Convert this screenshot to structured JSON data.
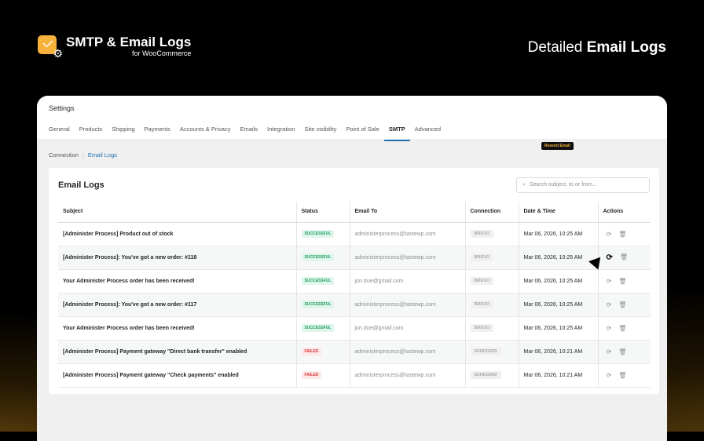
{
  "brand": {
    "title": "SMTP & Email Logs",
    "subtitle": "for WooCommerce"
  },
  "headline": {
    "normal": "Detailed ",
    "bold": "Email Logs"
  },
  "settings": {
    "title": "Settings",
    "tabs": [
      "General",
      "Products",
      "Shipping",
      "Payments",
      "Accounts & Privacy",
      "Emails",
      "Integration",
      "Site visibility",
      "Point of Sale",
      "SMTP",
      "Advanced"
    ],
    "active_tab": "SMTP"
  },
  "subnav": {
    "connection": "Connection",
    "separator": "|",
    "email_logs": "Email Logs"
  },
  "panel": {
    "title": "Email Logs",
    "search_placeholder": "Search subject, to or from...",
    "tooltip": "Resend Email"
  },
  "columns": [
    "Subject",
    "Status",
    "Email To",
    "Connection",
    "Date & Time",
    "Actions"
  ],
  "rows": [
    {
      "subject": "[Administer Process] Product out of stock",
      "status": "SUCCESSFUL",
      "to": "administerprocess@tastewp.com",
      "connection": "BREVO",
      "date": "Mar 06, 2026, 10:25 AM"
    },
    {
      "subject": "[Administer Process]: You've got a new order: #118",
      "status": "SUCCESSFUL",
      "to": "administerprocess@tastewp.com",
      "connection": "BREVO",
      "date": "Mar 06, 2026, 10:25 AM"
    },
    {
      "subject": "Your Administer Process order has been received!",
      "status": "SUCCESSFUL",
      "to": "jon.doe@gmail.com",
      "connection": "BREVO",
      "date": "Mar 06, 2026, 10:25 AM"
    },
    {
      "subject": "[Administer Process]: You've got a new order: #117",
      "status": "SUCCESSFUL",
      "to": "administerprocess@tastewp.com",
      "connection": "BREVO",
      "date": "Mar 06, 2026, 10:25 AM"
    },
    {
      "subject": "Your Administer Process order has been received!",
      "status": "SUCCESSFUL",
      "to": "jon.doe@gmail.com",
      "connection": "BREVO",
      "date": "Mar 06, 2026, 10:25 AM"
    },
    {
      "subject": "[Administer Process] Payment gateway \"Direct bank transfer\" enabled",
      "status": "FAILED",
      "to": "administerprocess@tastewp.com",
      "connection": "SENDGRID",
      "date": "Mar 06, 2026, 10:21 AM"
    },
    {
      "subject": "[Administer Process] Payment gateway \"Check payments\" enabled",
      "status": "FAILED",
      "to": "administerprocess@tastewp.com",
      "connection": "SENDGRID",
      "date": "Mar 06, 2026, 10:21 AM"
    }
  ]
}
